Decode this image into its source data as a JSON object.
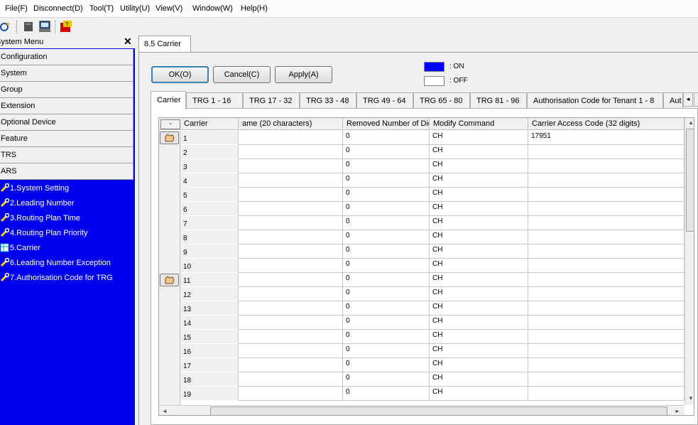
{
  "menubar": {
    "items": [
      "File(F)",
      "Disconnect(D)",
      "Tool(T)",
      "Utility(U)",
      "View(V)",
      "Window(W)",
      "Help(H)"
    ]
  },
  "toolbar": {
    "icons": [
      "wizard-icon",
      "module-icon",
      "pc-icon",
      "help-icon"
    ]
  },
  "system_menu": {
    "title": "System Menu",
    "close": "✕",
    "categories": [
      "Configuration",
      "System",
      "Group",
      "Extension",
      "Optional Device",
      "Feature",
      "TRS",
      "ARS"
    ],
    "ars_items": [
      "1.System Setting",
      "2.Leading Number",
      "3.Routing Plan Time",
      "4.Routing Plan Priority",
      "5.Carrier",
      "6.Leading Number Exception",
      "7.Authorisation Code for TRG"
    ]
  },
  "document": {
    "tab_title": "8.5 Carrier",
    "buttons": {
      "ok": "OK(O)",
      "cancel": "Cancel(C)",
      "apply": "Apply(A)"
    },
    "legend": {
      "on_label": ": ON",
      "off_label": ": OFF",
      "on_color": "#0000ff",
      "off_color": "#ffffff"
    },
    "tabs": [
      "Carrier",
      "TRG 1 - 16",
      "TRG 17 - 32",
      "TRG 33 - 48",
      "TRG 49 - 64",
      "TRG 65 - 80",
      "TRG 81 - 96",
      "Authorisation Code for Tenant 1 - 8",
      "Aut"
    ],
    "active_tab": "Carrier",
    "grid": {
      "collapse_label": "-",
      "columns": [
        "Carrier",
        "ame (20 characters)",
        "Removed Number of Dig",
        "Modify Command",
        "Carrier Access Code (32 digits)"
      ],
      "rows": [
        {
          "carrier": "1",
          "name": "",
          "removed": "0",
          "modify": "CH",
          "access": "17951"
        },
        {
          "carrier": "2",
          "name": "",
          "removed": "0",
          "modify": "CH",
          "access": ""
        },
        {
          "carrier": "3",
          "name": "",
          "removed": "0",
          "modify": "CH",
          "access": ""
        },
        {
          "carrier": "4",
          "name": "",
          "removed": "0",
          "modify": "CH",
          "access": ""
        },
        {
          "carrier": "5",
          "name": "",
          "removed": "0",
          "modify": "CH",
          "access": ""
        },
        {
          "carrier": "6",
          "name": "",
          "removed": "0",
          "modify": "CH",
          "access": ""
        },
        {
          "carrier": "7",
          "name": "",
          "removed": "0",
          "modify": "CH",
          "access": ""
        },
        {
          "carrier": "8",
          "name": "",
          "removed": "0",
          "modify": "CH",
          "access": ""
        },
        {
          "carrier": "9",
          "name": "",
          "removed": "0",
          "modify": "CH",
          "access": ""
        },
        {
          "carrier": "10",
          "name": "",
          "removed": "0",
          "modify": "CH",
          "access": ""
        },
        {
          "carrier": "11",
          "name": "",
          "removed": "0",
          "modify": "CH",
          "access": ""
        },
        {
          "carrier": "12",
          "name": "",
          "removed": "0",
          "modify": "CH",
          "access": ""
        },
        {
          "carrier": "13",
          "name": "",
          "removed": "0",
          "modify": "CH",
          "access": ""
        },
        {
          "carrier": "14",
          "name": "",
          "removed": "0",
          "modify": "CH",
          "access": ""
        },
        {
          "carrier": "15",
          "name": "",
          "removed": "0",
          "modify": "CH",
          "access": ""
        },
        {
          "carrier": "16",
          "name": "",
          "removed": "0",
          "modify": "CH",
          "access": ""
        },
        {
          "carrier": "17",
          "name": "",
          "removed": "0",
          "modify": "CH",
          "access": ""
        },
        {
          "carrier": "18",
          "name": "",
          "removed": "0",
          "modify": "CH",
          "access": ""
        },
        {
          "carrier": "19",
          "name": "",
          "removed": "0",
          "modify": "CH",
          "access": ""
        }
      ]
    }
  }
}
